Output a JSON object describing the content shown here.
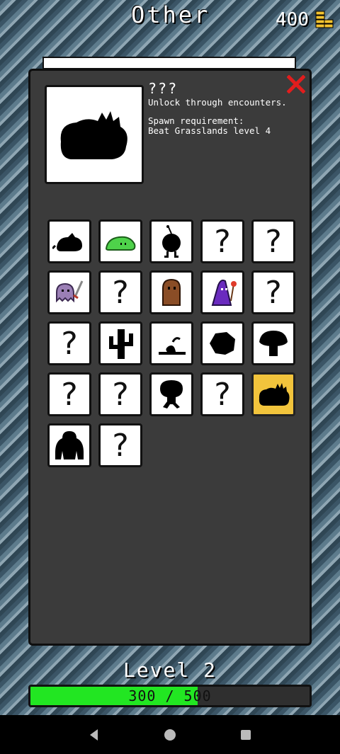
{
  "header": {
    "title": "Other",
    "coins": "400"
  },
  "detail": {
    "name": "???",
    "description": "Unlock through encounters.",
    "spawn_label": "Spawn requirement:",
    "spawn_value": "Beat Grasslands level 4"
  },
  "grid": {
    "cells": [
      {
        "kind": "silhouette",
        "icon": "rat-silhouette-icon"
      },
      {
        "kind": "creature",
        "icon": "green-slime-icon"
      },
      {
        "kind": "silhouette",
        "icon": "bomb-creature-icon"
      },
      {
        "kind": "unknown",
        "label": "?"
      },
      {
        "kind": "unknown",
        "label": "?"
      },
      {
        "kind": "creature",
        "icon": "purple-ghost-sword-icon"
      },
      {
        "kind": "unknown",
        "label": "?"
      },
      {
        "kind": "creature",
        "icon": "brown-ghost-icon"
      },
      {
        "kind": "creature",
        "icon": "purple-wizard-icon"
      },
      {
        "kind": "unknown",
        "label": "?"
      },
      {
        "kind": "unknown",
        "label": "?"
      },
      {
        "kind": "silhouette",
        "icon": "cactus-silhouette-icon"
      },
      {
        "kind": "silhouette",
        "icon": "worm-silhouette-icon"
      },
      {
        "kind": "silhouette",
        "icon": "rock-silhouette-icon"
      },
      {
        "kind": "silhouette",
        "icon": "mushroom-silhouette-icon"
      },
      {
        "kind": "unknown",
        "label": "?"
      },
      {
        "kind": "unknown",
        "label": "?"
      },
      {
        "kind": "silhouette",
        "icon": "tree-walker-silhouette-icon"
      },
      {
        "kind": "unknown",
        "label": "?"
      },
      {
        "kind": "silhouette",
        "icon": "bush-silhouette-icon",
        "selected": true
      },
      {
        "kind": "silhouette",
        "icon": "gorilla-silhouette-icon"
      },
      {
        "kind": "unknown",
        "label": "?"
      }
    ]
  },
  "level": {
    "label": "Level 2",
    "xp_text": "300 / 500",
    "xp_fraction": 0.6
  },
  "colors": {
    "panel": "#3b3b3b",
    "selected": "#f2c43c",
    "xp_fill": "#22e622",
    "close": "#e21d1d"
  }
}
